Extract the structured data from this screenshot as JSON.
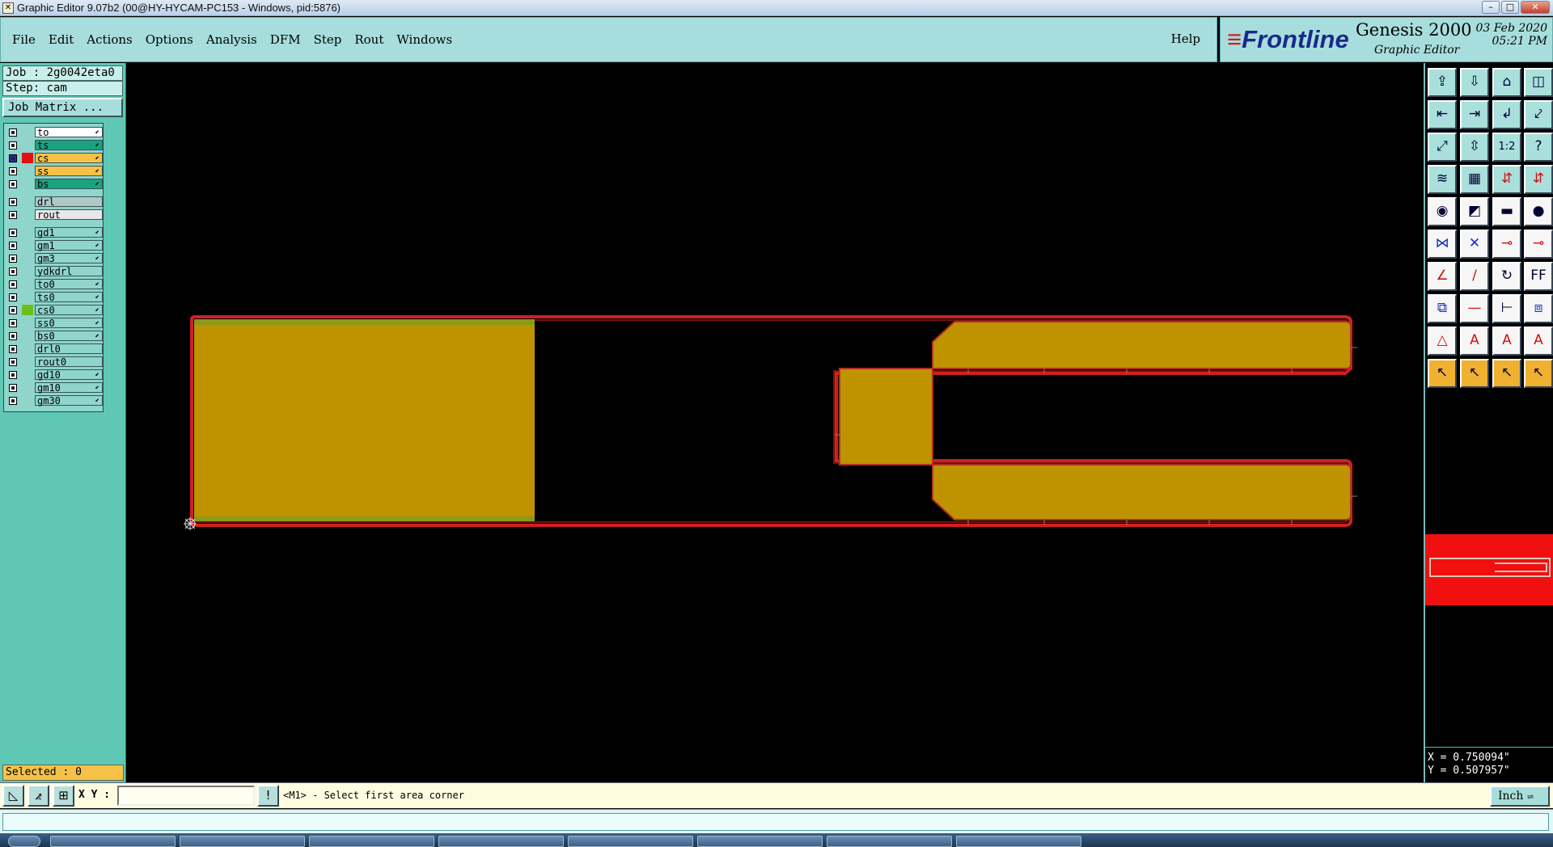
{
  "window": {
    "title": "Graphic Editor 9.07b2 (00@HY-HYCAM-PC153 - Windows, pid:5876)",
    "controls": {
      "minimize": "–",
      "maximize": "□",
      "close": "✕"
    }
  },
  "menu": [
    "File",
    "Edit",
    "Actions",
    "Options",
    "Analysis",
    "DFM",
    "Step",
    "Rout",
    "Windows"
  ],
  "help_label": "Help",
  "brand": {
    "logo_text": "Frontline",
    "product": "Genesis 2000",
    "subtitle": "Graphic Editor",
    "date": "03 Feb 2020",
    "time": "05:21 PM"
  },
  "job": {
    "job_label": "Job : 2g0042eta0",
    "step_label": "Step: cam",
    "matrix_button": "Job Matrix ..."
  },
  "layers": [
    {
      "name": "to",
      "color": "#ffffff",
      "has_arrow": true
    },
    {
      "name": "ts",
      "color": "#1aa37f",
      "has_arrow": true
    },
    {
      "name": "cs",
      "color": "#f5c247",
      "has_arrow": true,
      "active": true
    },
    {
      "name": "ss",
      "color": "#f5c247",
      "has_arrow": true
    },
    {
      "name": "bs",
      "color": "#1aa37f",
      "has_arrow": true
    },
    {
      "name": "drl",
      "color": "#b0c8c8",
      "has_arrow": false
    },
    {
      "name": "rout",
      "color": "#e8e8e8",
      "has_arrow": false
    },
    {
      "name": "gd1",
      "color": "#8fd5cc",
      "has_arrow": true
    },
    {
      "name": "gm1",
      "color": "#8fd5cc",
      "has_arrow": true
    },
    {
      "name": "gm3",
      "color": "#8fd5cc",
      "has_arrow": true
    },
    {
      "name": "ydkdrl",
      "color": "#8fd5cc",
      "has_arrow": false
    },
    {
      "name": "to0",
      "color": "#8fd5cc",
      "has_arrow": true
    },
    {
      "name": "ts0",
      "color": "#8fd5cc",
      "has_arrow": true
    },
    {
      "name": "cs0",
      "color": "#8fd5cc",
      "has_arrow": true,
      "mark": "#6bbf1a"
    },
    {
      "name": "ss0",
      "color": "#8fd5cc",
      "has_arrow": true
    },
    {
      "name": "bs0",
      "color": "#8fd5cc",
      "has_arrow": true
    },
    {
      "name": "drl0",
      "color": "#8fd5cc",
      "has_arrow": false
    },
    {
      "name": "rout0",
      "color": "#8fd5cc",
      "has_arrow": false
    },
    {
      "name": "gd10",
      "color": "#8fd5cc",
      "has_arrow": true
    },
    {
      "name": "gm10",
      "color": "#8fd5cc",
      "has_arrow": true
    },
    {
      "name": "gm30",
      "color": "#8fd5cc",
      "has_arrow": true
    }
  ],
  "selected_label": "Selected : 0",
  "toolbar_icons": [
    "zoom-home-icon",
    "zoom-fit-icon",
    "home-icon",
    "layout-icon",
    "pan-left-icon",
    "pan-right-icon",
    "snap-back-icon",
    "snap-icon",
    "zoom-extents-icon",
    "zoom-center-icon",
    "scale-1-2-icon",
    "help-question-icon",
    "layers-settings-icon",
    "grid-icon",
    "align-red-icon",
    "align-red-2-icon",
    "pad-icon",
    "line-diagonal-icon",
    "measure-ruler-icon",
    "circle-dot-icon",
    "connect-nodes-icon",
    "move-cross-icon",
    "node-link-icon",
    "node-link-2-icon",
    "draw-line-icon",
    "draw-slash-icon",
    "rotate-arc-icon",
    "mirror-ff-icon",
    "copy-shape-icon",
    "trim-line-icon",
    "dimension-icon",
    "select-shapes-icon",
    "triangle-edit-icon",
    "text-a-icon",
    "text-a-box-icon",
    "text-a-line-icon",
    "select-arrow-icon",
    "select-arrow-box-icon",
    "select-arrow-circle-icon",
    "select-arrow-net-icon"
  ],
  "toolbar_glyphs": [
    "⇪",
    "⇩",
    "⌂",
    "◫",
    "⇤",
    "⇥",
    "↲",
    "⤦",
    "⤢",
    "⇳",
    "1:2",
    "?",
    "≋",
    "▦",
    "⇵",
    "⇵",
    "◉",
    "◩",
    "▬",
    "●",
    "⋈",
    "✕",
    "⊸",
    "⊸",
    "∠",
    "/",
    "↻",
    "FF",
    "⧉",
    "—",
    "⊢",
    "⧈",
    "△",
    "A",
    "A",
    "A",
    "↖",
    "↖",
    "↖",
    "↖"
  ],
  "coords": {
    "x": "X = 0.750094\"",
    "y": "Y = 0.507957\""
  },
  "status": {
    "xy_label": "X Y :",
    "xy_value": "",
    "prompt": "<M1> - Select first area corner",
    "unit": "Inch"
  },
  "colors": {
    "panel": "#a7dedd",
    "copper": "#bf9300",
    "outline": "#d02020",
    "selected_bg": "#f5c247"
  }
}
